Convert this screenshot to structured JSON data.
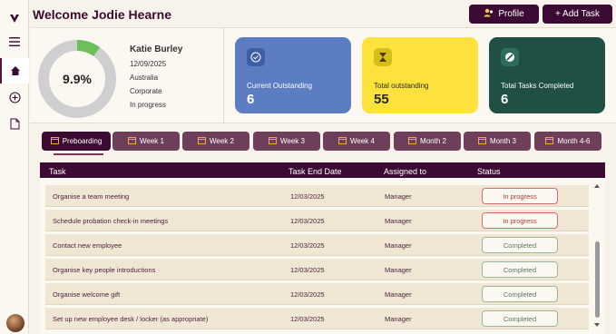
{
  "app": {
    "title": "Welcome Jodie Hearne"
  },
  "sidebar": {
    "items": [
      "logo",
      "menu",
      "home",
      "add",
      "pdf"
    ]
  },
  "header": {
    "profile_label": "Profile",
    "add_task_label": "+ Add Task"
  },
  "summary": {
    "progress_text": "9.9%",
    "progress_fraction": 0.099,
    "person": {
      "name": "Katie Burley",
      "date": "12/09/2025",
      "country": "Australia",
      "department": "Corporate",
      "status": "In progress"
    },
    "cards": [
      {
        "label": "Current Outstanding",
        "value": "6",
        "color": "#5b7dc4"
      },
      {
        "label": "Total outstanding",
        "value": "55",
        "color": "#fce23a"
      },
      {
        "label": "Total Tasks Completed",
        "value": "6",
        "color": "#1f4f45"
      }
    ]
  },
  "tabs": [
    "Preboarding",
    "Week 1",
    "Week 2",
    "Week 3",
    "Week 4",
    "Month 2",
    "Month 3",
    "Month 4-6"
  ],
  "table": {
    "headers": [
      "Task",
      "Task End Date",
      "Assigned to",
      "Status"
    ],
    "rows": [
      {
        "task": "Organise a team meeting",
        "date": "12/03/2025",
        "assigned": "Manager",
        "status": "In progress"
      },
      {
        "task": "Schedule probation check-in meetings",
        "date": "12/03/2025",
        "assigned": "Manager",
        "status": "In progress"
      },
      {
        "task": "Contact new employee",
        "date": "12/03/2025",
        "assigned": "Manager",
        "status": "Completed"
      },
      {
        "task": "Organise key people introductions",
        "date": "12/03/2025",
        "assigned": "Manager",
        "status": "Completed"
      },
      {
        "task": "Organise welcome gift",
        "date": "12/03/2025",
        "assigned": "Manager",
        "status": "Completed"
      },
      {
        "task": "Set up new employee desk / locker (as appropriate)",
        "date": "12/03/2025",
        "assigned": "Manager",
        "status": "Completed"
      }
    ]
  },
  "colors": {
    "primary": "#3b0b33",
    "tab": "#6e3f5a",
    "progress_green": "#6cbf5a",
    "in_progress": "#c0392b",
    "completed": "#5a7a5c"
  }
}
